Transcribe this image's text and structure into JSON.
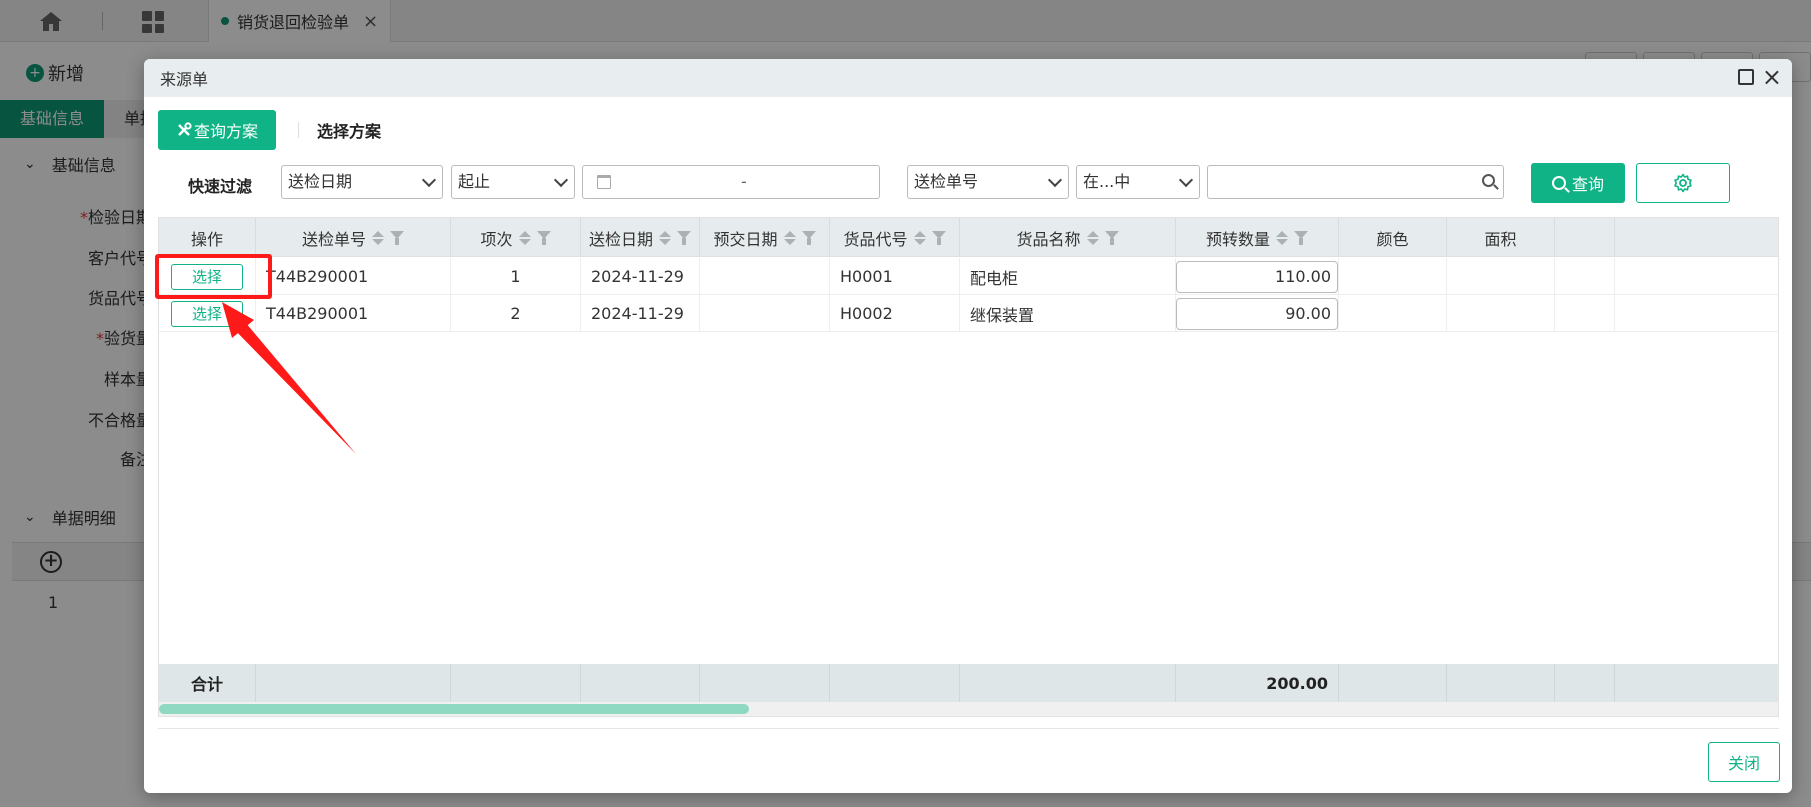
{
  "background": {
    "tab_title": "销货退回检验单",
    "tab_close": "×",
    "new_button": "新增",
    "section_tabs": [
      "基础信息",
      "单据"
    ],
    "section_basic": "基础信息",
    "labels": [
      "检验日期",
      "客户代号",
      "货品代号",
      "验货量",
      "样本量",
      "不合格量",
      "备注"
    ],
    "section_detail": "单据明细",
    "detail_row_no": "1"
  },
  "dialog": {
    "title": "来源单",
    "query_plan_button": "查询方案",
    "select_plan": "选择方案",
    "quick_filter_label": "快速过滤",
    "filter1_field": "送检日期",
    "filter1_op": "起止",
    "date_range_sep": "-",
    "filter2_field": "送检单号",
    "filter2_op": "在...中",
    "filter2_value": "",
    "query_button": "查询",
    "close_button": "关闭"
  },
  "table": {
    "columns": [
      "操作",
      "送检单号",
      "项次",
      "送检日期",
      "预交日期",
      "货品代号",
      "货品名称",
      "预转数量",
      "颜色",
      "面积"
    ],
    "rows": [
      {
        "action": "选择",
        "doc_no": "T44B290001",
        "item": "1",
        "date": "2024-11-29",
        "due": "",
        "code": "H0001",
        "name": "配电柜",
        "qty": "110.00",
        "color": "",
        "area": ""
      },
      {
        "action": "选择",
        "doc_no": "T44B290001",
        "item": "2",
        "date": "2024-11-29",
        "due": "",
        "code": "H0002",
        "name": "继保装置",
        "qty": "90.00",
        "color": "",
        "area": ""
      }
    ],
    "total_label": "合计",
    "total_qty": "200.00"
  },
  "colors": {
    "accent": "#10b386",
    "highlight": "#ff1a1a"
  }
}
